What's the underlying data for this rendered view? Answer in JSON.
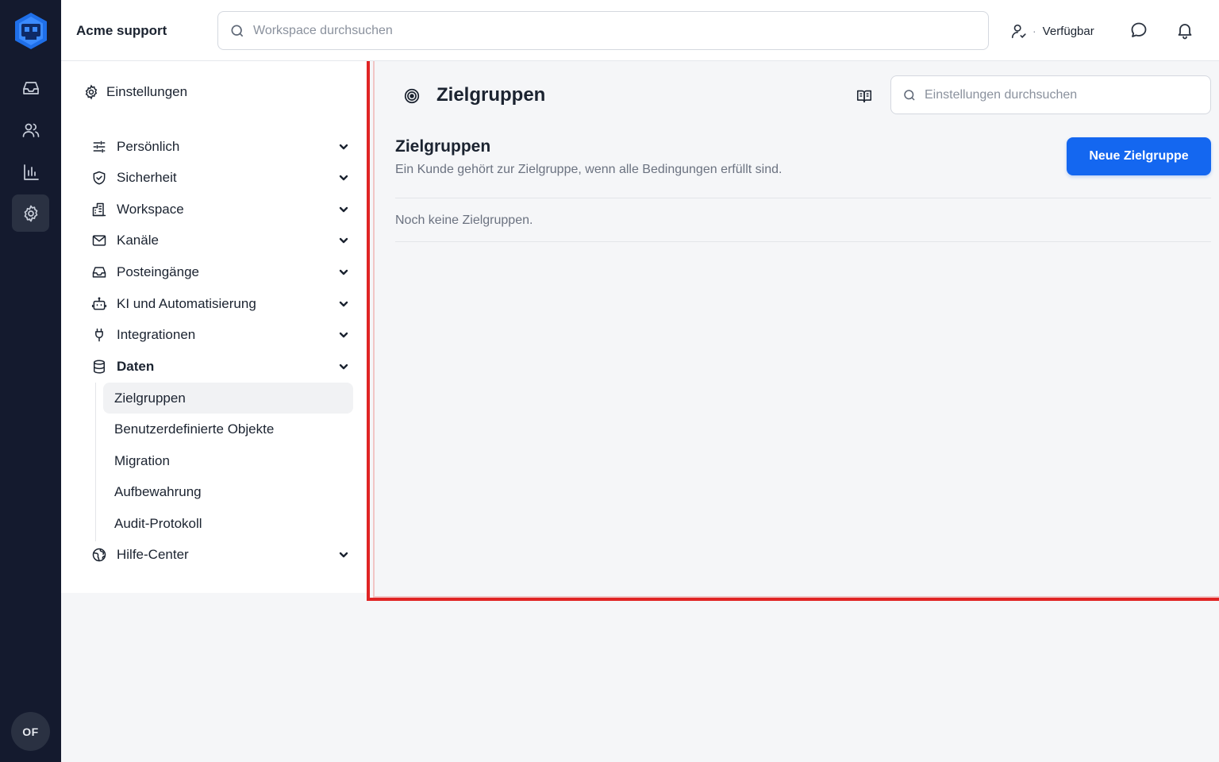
{
  "rail": {
    "avatar_initials": "OF",
    "items": [
      {
        "icon": "inbox-icon"
      },
      {
        "icon": "users-icon"
      },
      {
        "icon": "bar-chart-icon"
      },
      {
        "icon": "gear-icon",
        "active": true
      }
    ]
  },
  "topbar": {
    "brand": "Acme support",
    "search_placeholder": "Workspace durchsuchen",
    "status_dot": "·",
    "status_label": "Verfügbar"
  },
  "settings_nav": {
    "heading": "Einstellungen",
    "items": [
      {
        "label": "Persönlich",
        "icon": "sliders-icon"
      },
      {
        "label": "Sicherheit",
        "icon": "shield-icon"
      },
      {
        "label": "Workspace",
        "icon": "building-icon"
      },
      {
        "label": "Kanäle",
        "icon": "mail-icon"
      },
      {
        "label": "Posteingänge",
        "icon": "inbox-icon"
      },
      {
        "label": "KI und Automatisierung",
        "icon": "bot-icon"
      },
      {
        "label": "Integrationen",
        "icon": "plug-icon"
      },
      {
        "label": "Daten",
        "icon": "database-icon",
        "expanded": true
      },
      {
        "label": "Hilfe-Center",
        "icon": "globe-icon"
      }
    ],
    "data_subitems": [
      {
        "label": "Zielgruppen",
        "active": true
      },
      {
        "label": "Benutzerdefinierte Objekte"
      },
      {
        "label": "Migration"
      },
      {
        "label": "Aufbewahrung"
      },
      {
        "label": "Audit-Protokoll"
      }
    ]
  },
  "content": {
    "page_title": "Zielgruppen",
    "search_placeholder": "Einstellungen durchsuchen",
    "section_title": "Zielgruppen",
    "section_description": "Ein Kunde gehört zur Zielgruppe, wenn alle Bedingungen erfüllt sind.",
    "primary_button": "Neue Zielgruppe",
    "empty_state": "Noch keine Zielgruppen."
  },
  "colors": {
    "rail_bg": "#141a2e",
    "accent": "#1467f0",
    "highlight_border": "#e02424"
  }
}
